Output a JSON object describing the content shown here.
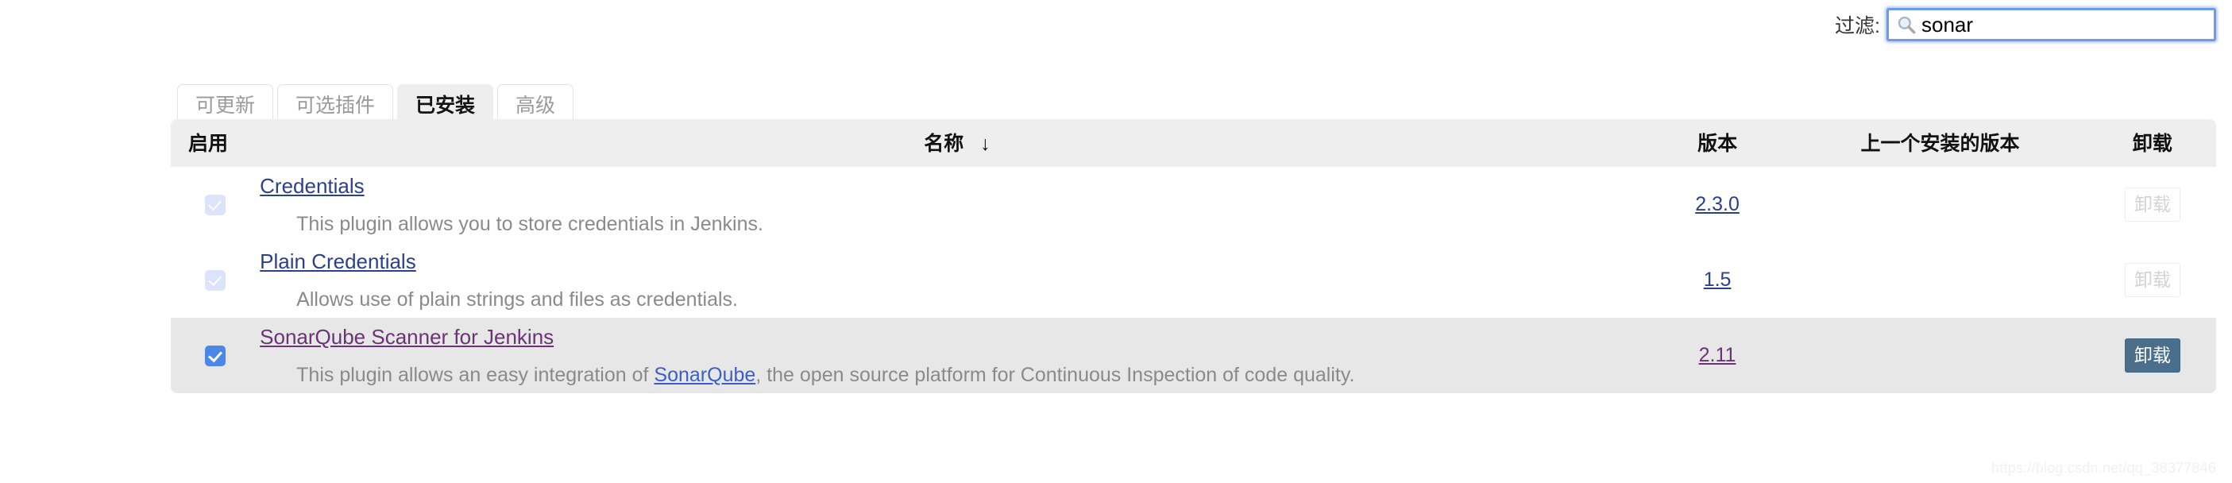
{
  "filter": {
    "label": "过滤:",
    "value": "sonar",
    "placeholder": "",
    "icon": "search-icon"
  },
  "tabs": [
    {
      "label": "可更新",
      "active": false
    },
    {
      "label": "可选插件",
      "active": false
    },
    {
      "label": "已安装",
      "active": true
    },
    {
      "label": "高级",
      "active": false
    }
  ],
  "table": {
    "headers": {
      "enable": "启用",
      "name": "名称",
      "sort_indicator": "↓",
      "version": "版本",
      "previous_version": "上一个安装的版本",
      "uninstall": "卸载"
    },
    "rows": [
      {
        "enabled": true,
        "enabled_locked": true,
        "title": "Credentials",
        "title_visited": false,
        "description_before": "This plugin allows you to store credentials in Jenkins.",
        "description_link": "",
        "description_after": "",
        "version": "2.3.0",
        "version_visited": false,
        "previous_version": "",
        "uninstall_label": "卸载",
        "uninstall_enabled": false,
        "highlight": false
      },
      {
        "enabled": true,
        "enabled_locked": true,
        "title": "Plain Credentials",
        "title_visited": false,
        "description_before": "Allows use of plain strings and files as credentials.",
        "description_link": "",
        "description_after": "",
        "version": "1.5",
        "version_visited": false,
        "previous_version": "",
        "uninstall_label": "卸载",
        "uninstall_enabled": false,
        "highlight": false
      },
      {
        "enabled": true,
        "enabled_locked": false,
        "title": "SonarQube Scanner for Jenkins",
        "title_visited": true,
        "description_before": "This plugin allows an easy integration of ",
        "description_link": "SonarQube",
        "description_after": ", the open source platform for Continuous Inspection of code quality.",
        "version": "2.11",
        "version_visited": true,
        "previous_version": "",
        "uninstall_label": "卸载",
        "uninstall_enabled": true,
        "highlight": true
      }
    ]
  },
  "watermark": "https://blog.csdn.net/qq_38377846",
  "colors": {
    "link": "#2b3f8f",
    "link_visited": "#6a3374",
    "checkbox_on": "#4a87e8",
    "checkbox_off": "#dbe4fb",
    "button_primary": "#4b6f8a",
    "header_bg": "#eeeeee",
    "row_highlight": "#e7e7e7",
    "focus_outline": "#6f9aea"
  }
}
